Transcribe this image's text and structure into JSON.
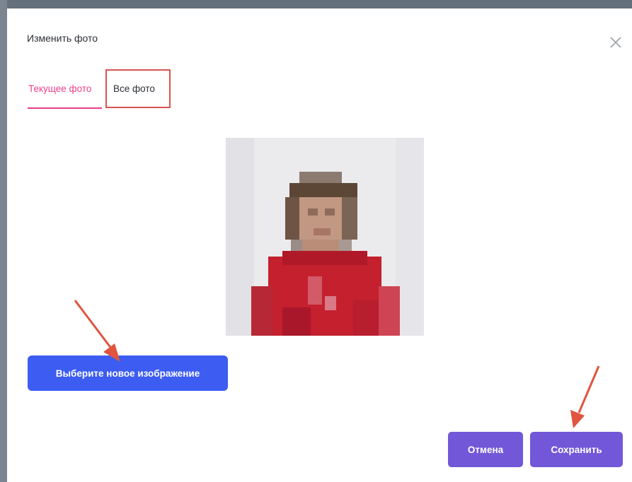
{
  "dialog": {
    "title": "Изменить фото",
    "close_icon": "close-icon"
  },
  "tabs": [
    {
      "label": "Текущее фото",
      "active": true
    },
    {
      "label": "Все фото",
      "active": false
    }
  ],
  "colors": {
    "accent_tab": "#ec3f8c",
    "primary_button": "#3c5cf2",
    "secondary_button": "#7257d8",
    "annotation": "#d9534f"
  },
  "photo": {
    "description_icon": "user-photo"
  },
  "actions": {
    "choose_image": "Выберите новое изображение",
    "cancel": "Отмена",
    "save": "Сохранить"
  }
}
